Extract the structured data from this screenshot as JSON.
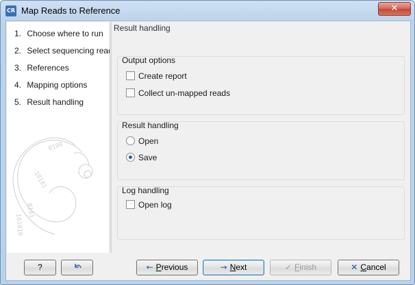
{
  "window": {
    "title": "Map Reads to Reference",
    "icon_text": "CR",
    "close_glyph": "✕"
  },
  "steps": [
    {
      "num": "1.",
      "label": "Choose where to run"
    },
    {
      "num": "2.",
      "label": "Select sequencing reads"
    },
    {
      "num": "3.",
      "label": "References"
    },
    {
      "num": "4.",
      "label": "Mapping options"
    },
    {
      "num": "5.",
      "label": "Result handling"
    }
  ],
  "panel": {
    "title": "Result handling",
    "output_options": {
      "title": "Output options",
      "create_report": {
        "label": "Create report",
        "checked": false
      },
      "collect_unmapped": {
        "label": "Collect un-mapped reads",
        "checked": false
      }
    },
    "result_handling": {
      "title": "Result handling",
      "open": {
        "label": "Open",
        "selected": false
      },
      "save": {
        "label": "Save",
        "selected": true
      }
    },
    "log_handling": {
      "title": "Log handling",
      "open_log": {
        "label": "Open log",
        "checked": false
      }
    }
  },
  "buttons": {
    "help": {
      "label": "?"
    },
    "reset": {
      "icon": "undo-arrow-icon"
    },
    "previous": {
      "label_first": "P",
      "label_rest": "revious"
    },
    "next": {
      "label_first": "N",
      "label_rest": "ext"
    },
    "finish": {
      "label_first": "F",
      "label_rest": "inish"
    },
    "cancel": {
      "label_first": "C",
      "label_rest": "ancel"
    }
  },
  "colors": {
    "titlebar": "#bcd3ec",
    "accent_blue": "#2a5aa0",
    "close_red": "#c24534"
  }
}
